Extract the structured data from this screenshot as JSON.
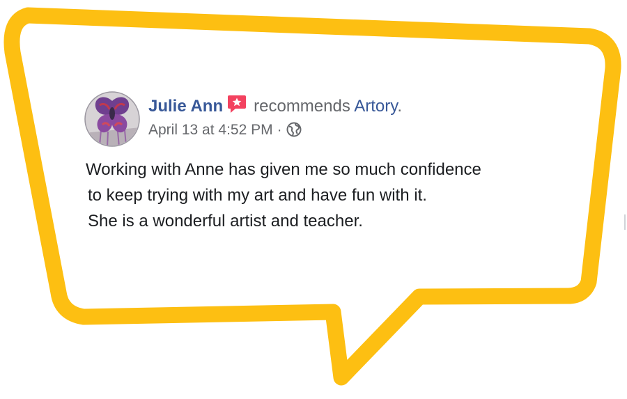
{
  "post": {
    "author": "Julie Ann",
    "action": "recommends",
    "page": "Artory",
    "period": ".",
    "timestamp": "April 13 at 4:52 PM",
    "separator": "·",
    "privacy_icon": "globe-icon",
    "recommendation_icon": "star-flag-icon",
    "text_lines": [
      "Working with Anne has given me so much confidence",
      "to keep trying with my art and have fun with it.",
      "She is a wonderful artist and teacher."
    ]
  },
  "colors": {
    "bubble_outline": "#FDBF12",
    "author_link": "#385898",
    "meta_text": "#65676B",
    "recommend_badge": "#F3425F",
    "body_text": "#1C1E21"
  }
}
